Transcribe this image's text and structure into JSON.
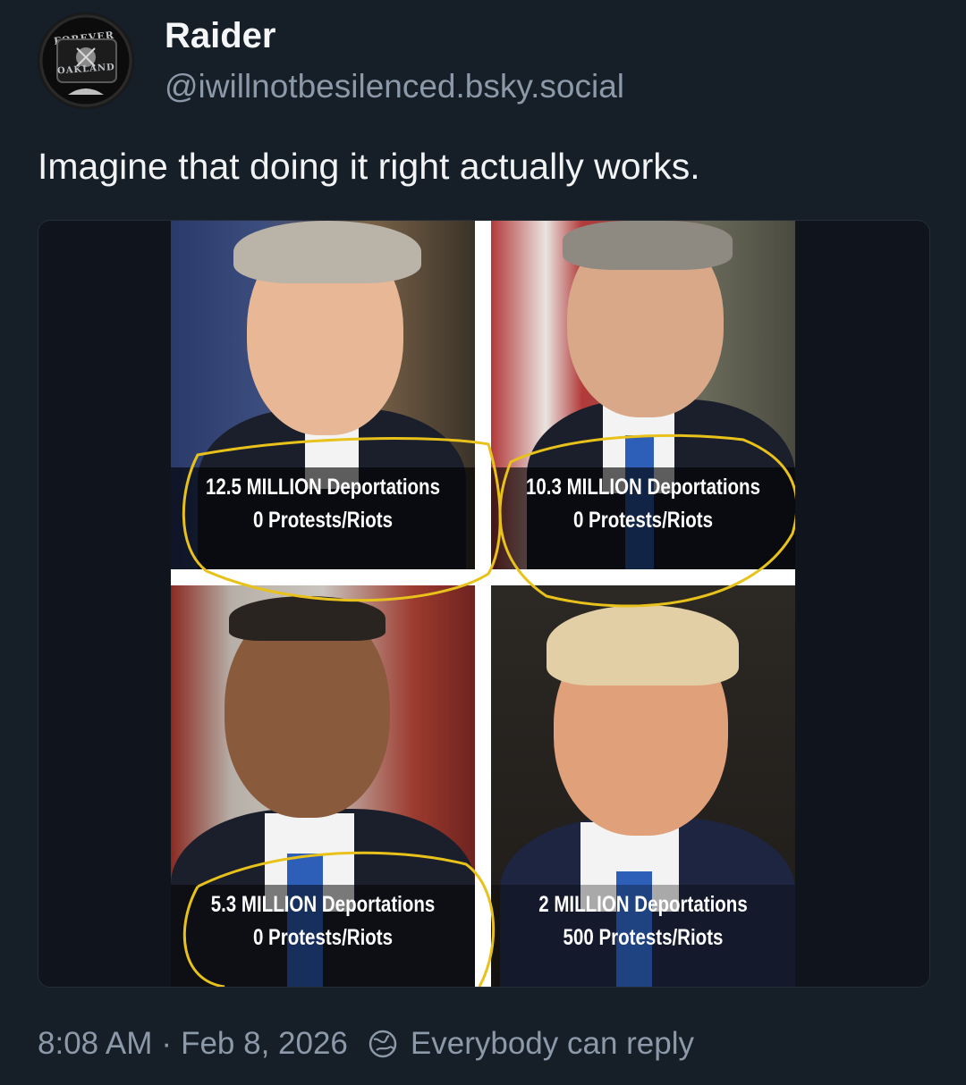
{
  "author": {
    "display_name": "Raider",
    "handle": "@iwillnotbesilenced.bsky.social",
    "avatar_text_top": "FOREVER",
    "avatar_text_bottom": "OAKLAND"
  },
  "post": {
    "text": "Imagine that doing it right actually works."
  },
  "image": {
    "panels": [
      {
        "line1": "12.5 MILLION Deportations",
        "line2": "0 Protests/Riots"
      },
      {
        "line1": "10.3 MILLION Deportations",
        "line2": "0 Protests/Riots"
      },
      {
        "line1": "5.3 MILLION Deportations",
        "line2": "0 Protests/Riots"
      },
      {
        "line1": "2 MILLION Deportations",
        "line2": "500 Protests/Riots"
      }
    ]
  },
  "footer": {
    "time": "8:08 AM",
    "separator": "·",
    "date": "Feb 8, 2026",
    "reply_setting": "Everybody can reply",
    "reply_icon": "globe-icon"
  },
  "colors": {
    "background": "#161e27",
    "text": "#f1f3f5",
    "muted": "#8c99a8",
    "highlight": "#e8c21a"
  }
}
